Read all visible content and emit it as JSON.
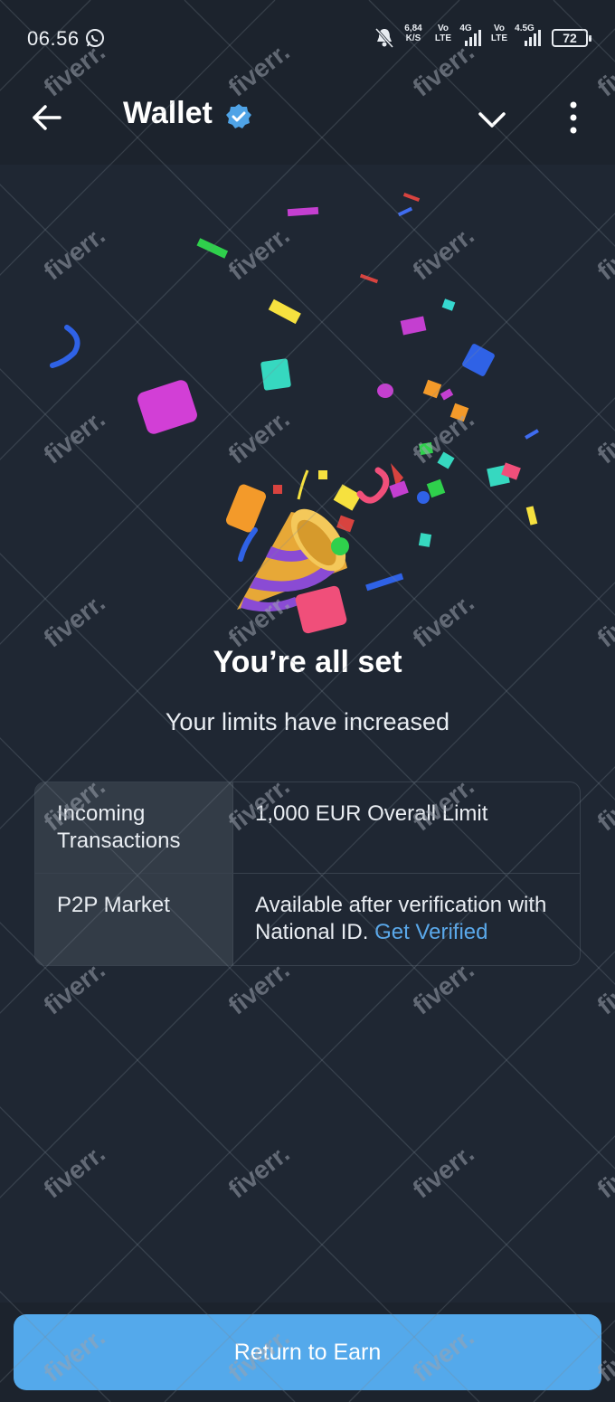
{
  "status_bar": {
    "time": "06.56",
    "net_speed_top": "6,84",
    "net_speed_unit": "K/S",
    "volte1_top": "Vo",
    "volte1_bottom": "LTE",
    "signal1_label": "4G",
    "volte2_top": "Vo",
    "volte2_bottom": "LTE",
    "signal2_label": "4.5G",
    "battery": "72"
  },
  "app_bar": {
    "title": "Wallet"
  },
  "main": {
    "headline": "You’re all set",
    "subline": "Your limits have increased",
    "limits": [
      {
        "label": "Incoming Transactions",
        "value": "1,000 EUR Overall Limit"
      },
      {
        "label": "P2P Market",
        "value": "Available after verification with National ID.",
        "link": "Get Verified"
      }
    ]
  },
  "footer": {
    "button_label": "Return to Earn"
  },
  "watermark": {
    "text": "fiverr."
  },
  "colors": {
    "background": "#1f2733",
    "bar": "#1c232d",
    "accent": "#54a9eb",
    "link": "#5aa8ea",
    "table_label_bg": "#333c47"
  }
}
